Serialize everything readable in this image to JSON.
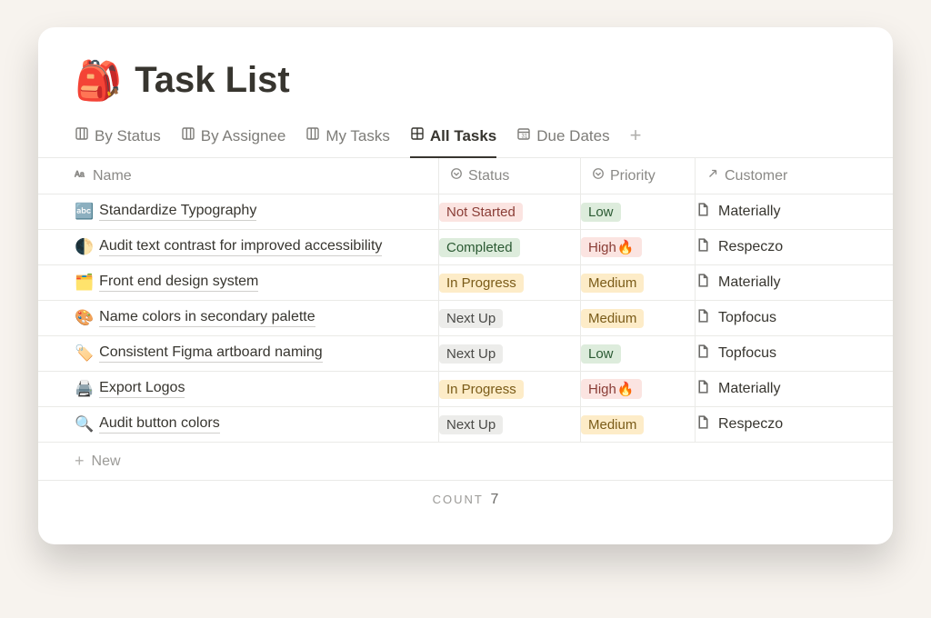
{
  "header": {
    "icon": "🎒",
    "title": "Task List"
  },
  "tabs": [
    {
      "label": "By Status",
      "icon": "board",
      "active": false
    },
    {
      "label": "By Assignee",
      "icon": "board",
      "active": false
    },
    {
      "label": "My Tasks",
      "icon": "board",
      "active": false
    },
    {
      "label": "All Tasks",
      "icon": "table",
      "active": true
    },
    {
      "label": "Due Dates",
      "icon": "calendar",
      "active": false
    }
  ],
  "columns": {
    "name": "Name",
    "status": "Status",
    "priority": "Priority",
    "customer": "Customer"
  },
  "rows": [
    {
      "emoji": "🔤",
      "title": "Standardize Typography",
      "status": "Not Started",
      "status_style": "red",
      "priority": "Low",
      "priority_style": "green",
      "fire": false,
      "customer": "Materially"
    },
    {
      "emoji": "🌓",
      "title": "Audit text contrast for improved accessibility",
      "status": "Completed",
      "status_style": "green",
      "priority": "High",
      "priority_style": "highred",
      "fire": true,
      "customer": "Respeczo"
    },
    {
      "emoji": "🗂️",
      "title": "Front end design system",
      "status": "In Progress",
      "status_style": "yellow",
      "priority": "Medium",
      "priority_style": "yellow",
      "fire": false,
      "customer": "Materially"
    },
    {
      "emoji": "🎨",
      "title": "Name colors in secondary palette",
      "status": "Next Up",
      "status_style": "gray",
      "priority": "Medium",
      "priority_style": "yellow",
      "fire": false,
      "customer": "Topfocus"
    },
    {
      "emoji": "🏷️",
      "title": "Consistent Figma artboard naming",
      "status": "Next Up",
      "status_style": "gray",
      "priority": "Low",
      "priority_style": "green",
      "fire": false,
      "customer": "Topfocus"
    },
    {
      "emoji": "🖨️",
      "title": "Export Logos",
      "status": "In Progress",
      "status_style": "yellow",
      "priority": "High",
      "priority_style": "highred",
      "fire": true,
      "customer": "Materially"
    },
    {
      "emoji": "🔍",
      "title": "Audit button colors",
      "status": "Next Up",
      "status_style": "gray",
      "priority": "Medium",
      "priority_style": "yellow",
      "fire": false,
      "customer": "Respeczo"
    }
  ],
  "new_row_label": "New",
  "footer": {
    "count_label": "COUNT",
    "count_value": "7"
  },
  "fire_emoji": "🔥"
}
